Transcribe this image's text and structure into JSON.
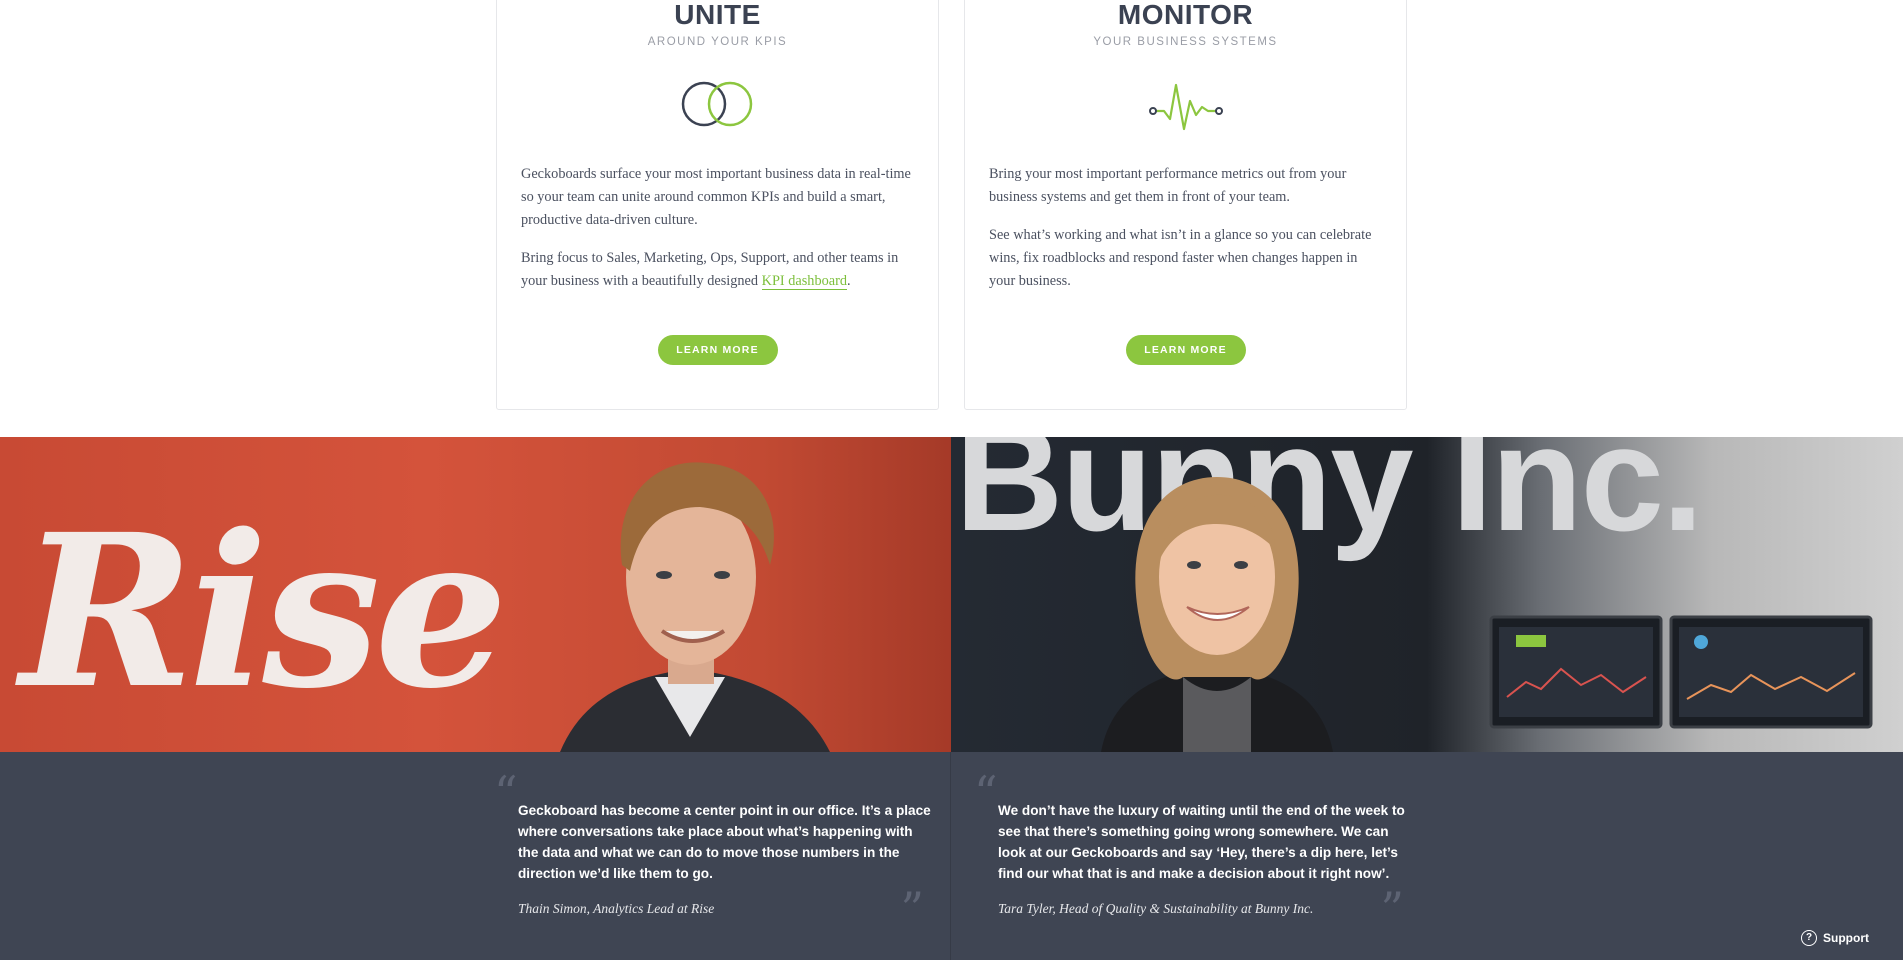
{
  "cards": [
    {
      "title": "UNITE",
      "subtitle": "AROUND YOUR KPIS",
      "icon": "linked-circles-icon",
      "paragraph1": "Geckoboards surface your most important business data in real-time so your team can unite around common KPIs and build a smart, productive data-driven culture.",
      "paragraph2_before": "Bring focus to Sales, Marketing, Ops, Support, and other teams in your business with a beautifully designed ",
      "paragraph2_link": "KPI dashboard",
      "paragraph2_after": ".",
      "button_label": "LEARN MORE"
    },
    {
      "title": "MONITOR",
      "subtitle": "YOUR BUSINESS SYSTEMS",
      "icon": "heartbeat-pulse-icon",
      "paragraph1": "Bring your most important performance metrics out from your business systems and get them in front of your team.",
      "paragraph2": "See what’s working and what isn’t in a glance so you can celebrate wins, fix roadblocks and respond faster when changes happen in your business.",
      "button_label": "LEARN MORE"
    }
  ],
  "photos": {
    "left_logo": "Rise",
    "right_logo": "Bunny Inc."
  },
  "testimonials": [
    {
      "quote": "Geckoboard has become a center point in our office. It’s a place where conversations take place about what’s happening with the data and what we can do to move those numbers in the direction we’d like them to go.",
      "author": "Thain Simon, Analytics Lead at Rise"
    },
    {
      "quote": "We don’t have the luxury of waiting until the end of the week to see that there’s something going wrong somewhere. We can look at our Geckoboards and say ‘Hey, there’s a dip here, let’s find our what that is and make a decision about it right now’.",
      "author": "Tara Tyler, Head of Quality & Sustainability at Bunny Inc."
    }
  ],
  "quote_marks": {
    "open": "“",
    "close": "”"
  },
  "support": {
    "label": "Support",
    "icon": "question-circle-icon",
    "glyph": "?"
  },
  "colors": {
    "accent": "#8cc63f",
    "dark": "#3f4553",
    "text": "#3b4252"
  }
}
